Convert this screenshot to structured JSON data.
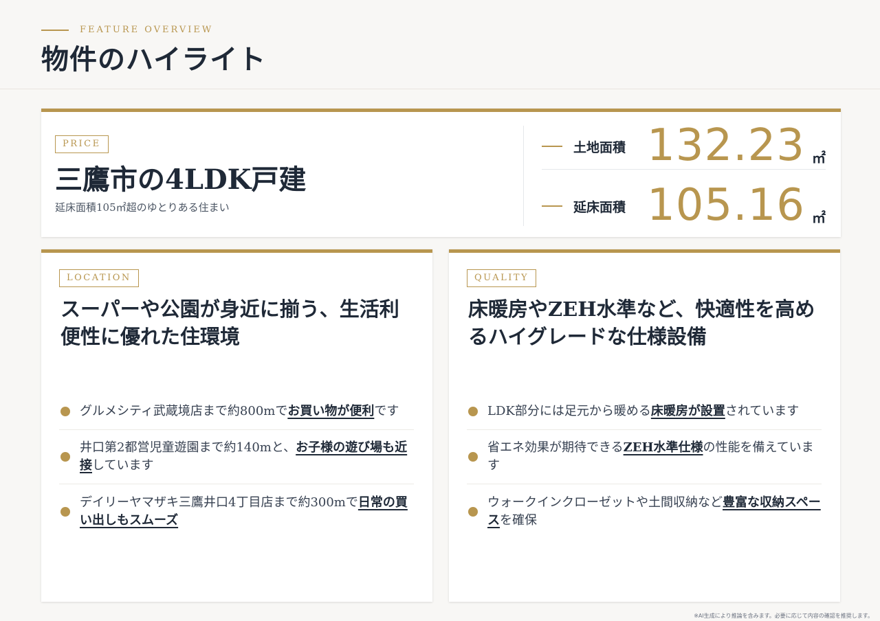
{
  "header": {
    "eyebrow": "FEATURE OVERVIEW",
    "title": "物件のハイライト"
  },
  "price": {
    "tag": "PRICE",
    "title": "三鷹市の4LDK戸建",
    "subtitle": "延床面積105㎡超のゆとりある住まい",
    "metrics": [
      {
        "label": "土地面積",
        "value": "132.23",
        "unit": "㎡"
      },
      {
        "label": "延床面積",
        "value": "105.16",
        "unit": "㎡"
      }
    ]
  },
  "location": {
    "tag": "LOCATION",
    "title": "スーパーや公園が身近に揃う、生活利便性に優れた住環境",
    "items": [
      {
        "pre": "グルメシティ武蔵境店まで約800mで",
        "em": "お買い物が便利",
        "post": "です"
      },
      {
        "pre": "井口第2都営児童遊園まで約140mと、",
        "em": "お子様の遊び場も近接",
        "post": "しています"
      },
      {
        "pre": "デイリーヤマザキ三鷹井口4丁目店まで約300mで",
        "em": "日常の買い出しもスムーズ",
        "post": ""
      }
    ]
  },
  "quality": {
    "tag": "QUALITY",
    "title": "床暖房やZEH水準など、快適性を高めるハイグレードな仕様設備",
    "items": [
      {
        "pre": "LDK部分には足元から暖める",
        "em": "床暖房が設置",
        "post": "されています"
      },
      {
        "pre": "省エネ効果が期待できる",
        "em": "ZEH水準仕様",
        "post": "の性能を備えています"
      },
      {
        "pre": "ウォークインクローゼットや土間収納など",
        "em": "豊富な収納スペース",
        "post": "を確保"
      }
    ]
  },
  "footer": {
    "note": "※AI生成により推論を含みます。必要に応じて内容の確認を推奨します。"
  },
  "colors": {
    "accent": "#b8964f",
    "text": "#1f2937",
    "background": "#f8f7f5"
  }
}
